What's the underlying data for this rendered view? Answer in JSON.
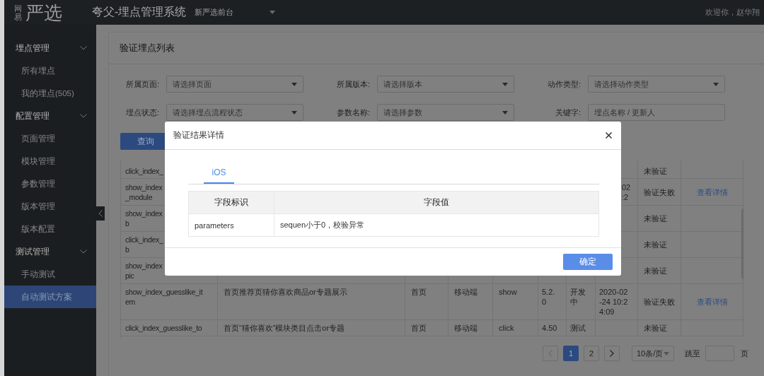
{
  "header": {
    "logo_small": "网易",
    "logo_large": "严选",
    "title": "夸父-埋点管理系统",
    "project": "新严选前台",
    "welcome": "欢迎你，赵华翔"
  },
  "sidebar": {
    "groups": [
      {
        "label": "埋点管理",
        "expanded": true,
        "items": [
          {
            "label": "所有埋点",
            "selected": false
          },
          {
            "label": "我的埋点(505)",
            "selected": false
          }
        ]
      },
      {
        "label": "配置管理",
        "expanded": true,
        "items": [
          {
            "label": "页面管理",
            "selected": false
          },
          {
            "label": "模块管理",
            "selected": false
          },
          {
            "label": "参数管理",
            "selected": false
          },
          {
            "label": "版本管理",
            "selected": false
          },
          {
            "label": "版本配置",
            "selected": false
          }
        ]
      },
      {
        "label": "测试管理",
        "expanded": true,
        "items": [
          {
            "label": "手动测试",
            "selected": false
          },
          {
            "label": "自动测试方案",
            "selected": true
          }
        ]
      }
    ]
  },
  "page": {
    "title": "验证埋点列表",
    "filters": [
      {
        "kind": "select",
        "label": "所属页面:",
        "placeholder": "请选择页面"
      },
      {
        "kind": "select",
        "label": "所属版本:",
        "placeholder": "请选择版本"
      },
      {
        "kind": "select",
        "label": "动作类型:",
        "placeholder": "请选择动作类型"
      },
      {
        "kind": "select",
        "label": "埋点状态:",
        "placeholder": "请选择埋点流程状态"
      },
      {
        "kind": "select",
        "label": "参数名称:",
        "placeholder": "请选择参数"
      },
      {
        "kind": "input",
        "label": "关键字:",
        "placeholder": "埋点名称 / 更新人"
      }
    ],
    "query_button": "查询",
    "table": {
      "rows": [
        {
          "name": "click_index_",
          "verify_result": "未验证"
        },
        {
          "name": "show_index\n_module",
          "updated": "02\n:2",
          "verify_result": "验证失败",
          "operation": "查看详情"
        },
        {
          "name": "show_index\nb",
          "verify_result": "未验证"
        },
        {
          "name": "click_index_\nb",
          "verify_result": "未验证"
        },
        {
          "name": "show_index\npic",
          "verify_result": "未验证"
        },
        {
          "name": "show_index_guesslike_it\nem",
          "description": "首页推荐页猜你喜欢商品or专题展示",
          "page": "首页",
          "terminal": "移动端",
          "action": "show",
          "version": "5.2.\n0",
          "status": "开发中",
          "updated": "2020-02\n-24 10:2\n4:09",
          "verify_result": "验证失败",
          "operation": "查看详情"
        },
        {
          "name": "click_index_guesslike_to",
          "description": "首页“猜你喜欢”模块类目点击or专题",
          "page": "首页",
          "terminal": "移动端",
          "action": "click",
          "version": "4.50",
          "status": "测试",
          "verify_result": "未验证"
        }
      ]
    },
    "pagination": {
      "prev_disabled": true,
      "next_disabled": false,
      "pages": [
        {
          "label": "1",
          "selected": true
        },
        {
          "label": "2",
          "selected": false
        }
      ],
      "page_size": "10条/页",
      "jump_label": "跳至",
      "jump_unit": "页"
    }
  },
  "modal": {
    "title": "验证结果详情",
    "tabs": [
      {
        "label": "iOS",
        "selected": true
      }
    ],
    "table": {
      "columns": [
        "字段标识",
        "字段值"
      ],
      "rows": [
        [
          "parameters",
          "sequen小于0，校验异常"
        ]
      ]
    },
    "buttons": [
      "确定"
    ]
  }
}
